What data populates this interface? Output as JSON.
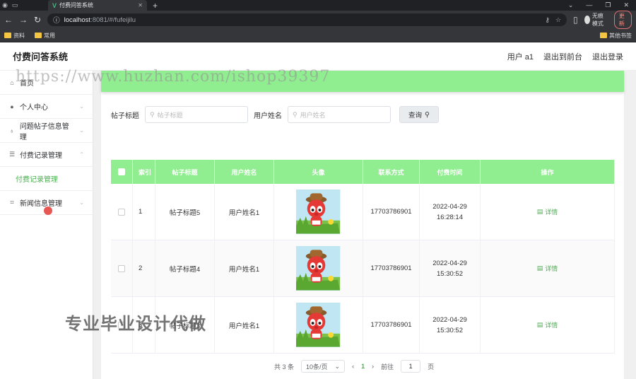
{
  "browser": {
    "tab_title": "付费问答系统",
    "url_host": "localhost",
    "url_path": ":8081/#/fufeijilu",
    "profile_label": "无痕模式",
    "update_label": "更新",
    "bookmarks": [
      "资料",
      "常用"
    ],
    "bookmark_right": "其他书签"
  },
  "app": {
    "title": "付费问答系统",
    "user": "用户 a1",
    "back_front": "退出到前台",
    "logout": "退出登录"
  },
  "sidebar": {
    "items": [
      {
        "label": "首页",
        "icon": "home-icon"
      },
      {
        "label": "个人中心",
        "icon": "user-icon"
      },
      {
        "label": "问题帖子信息管理",
        "icon": "mic-icon"
      },
      {
        "label": "付费记录管理",
        "icon": "settings-icon"
      },
      {
        "label": "付费记录管理",
        "sub": true
      },
      {
        "label": "新闻信息管理",
        "icon": "crop-icon"
      }
    ]
  },
  "search": {
    "label_title": "帖子标题",
    "placeholder_title": "帖子标题",
    "label_user": "用户姓名",
    "placeholder_user": "用户姓名",
    "button": "查询"
  },
  "table": {
    "headers": [
      "索引",
      "帖子标题",
      "用户姓名",
      "头像",
      "联系方式",
      "付费时间",
      "操作"
    ],
    "rows": [
      {
        "index": "1",
        "title": "帖子标题5",
        "user": "用户姓名1",
        "phone": "17703786901",
        "time": "2022-04-29 16:28:14",
        "op": "详情"
      },
      {
        "index": "2",
        "title": "帖子标题4",
        "user": "用户姓名1",
        "phone": "17703786901",
        "time": "2022-04-29 15:30:52",
        "op": "详情"
      },
      {
        "index": "3",
        "title": "帖子标题3",
        "user": "用户姓名1",
        "phone": "17703786901",
        "time": "2022-04-29 15:30:52",
        "op": "详情"
      }
    ]
  },
  "pagination": {
    "total": "共 3 条",
    "page_size": "10条/页",
    "current": "1",
    "goto_label": "前往",
    "goto_value": "1",
    "page_suffix": "页"
  },
  "watermarks": {
    "top": "https://www.huzhan.com/ishop39397",
    "mid": "专业毕业设计代做"
  },
  "colors": {
    "accent": "#90ee90",
    "link": "#4caf50"
  }
}
